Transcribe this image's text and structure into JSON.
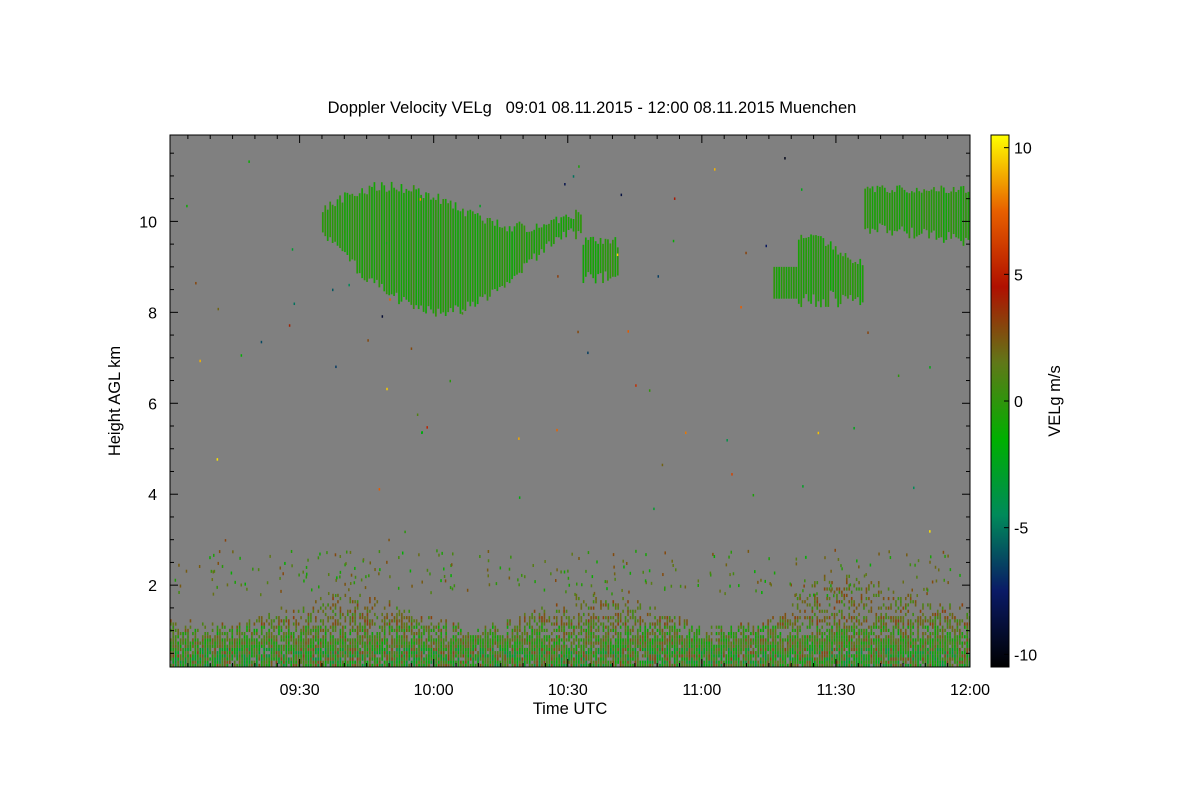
{
  "chart_data": {
    "type": "heatmap",
    "title": "Doppler Velocity VELg   09:01 08.11.2015 - 12:00 08.11.2015 Muenchen",
    "xlabel": "Time UTC",
    "ylabel": "Height AGL km",
    "x_range": [
      "09:01",
      "12:00"
    ],
    "x_ticks": [
      "09:30",
      "10:00",
      "10:30",
      "11:00",
      "11:30",
      "12:00"
    ],
    "y_range_km": [
      0.2,
      11.9
    ],
    "y_ticks": [
      2,
      4,
      6,
      8,
      10
    ],
    "colorbar": {
      "label": "VELg m/s",
      "range": [
        -10.5,
        10.5
      ],
      "ticks": [
        10,
        5,
        0,
        -5,
        -10
      ],
      "colors": [
        "#000000",
        "#0a1a66",
        "#008a5a",
        "#00b000",
        "#607818",
        "#b01000",
        "#e86000",
        "#ffff00"
      ]
    },
    "background_color": "#808080",
    "features": [
      {
        "label": "upper cloud",
        "time_start": "09:35",
        "time_end": "10:41",
        "height_km": [
          7.7,
          10.8
        ],
        "velocity_ms": -0.5
      },
      {
        "label": "upper cloud",
        "time_start": "11:16",
        "time_end": "12:00",
        "height_km": [
          8.0,
          11.0
        ],
        "velocity_ms": -0.5
      },
      {
        "label": "boundary layer",
        "time_start": "09:01",
        "time_end": "12:00",
        "height_km": [
          0.2,
          2.1
        ],
        "velocity_ms": "-2 to 3"
      }
    ]
  }
}
